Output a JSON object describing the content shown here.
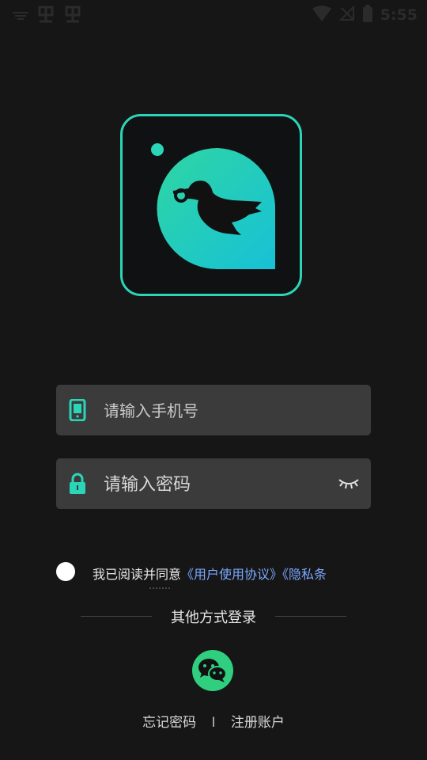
{
  "status_bar": {
    "time": "5:55",
    "icons": [
      "notification-icon",
      "app-icon",
      "app-icon",
      "wifi-icon",
      "no-signal-icon",
      "battery-icon"
    ]
  },
  "colors": {
    "accent": "#2bd6b8",
    "link": "#7aa8ff",
    "wechat": "#2fcf7f",
    "background": "#161616",
    "input_bg": "#3b3b3b"
  },
  "login": {
    "phone_placeholder": "请输入手机号",
    "password_placeholder": "请输入密码"
  },
  "agreement": {
    "prefix": "我已阅读并同意",
    "user_agreement": "《用户使用协议》",
    "privacy_policy": "《隐私条"
  },
  "other_login": {
    "label": "其他方式登录"
  },
  "bottom_links": {
    "forgot_password": "忘记密码",
    "separator": "I",
    "register": "注册账户"
  }
}
